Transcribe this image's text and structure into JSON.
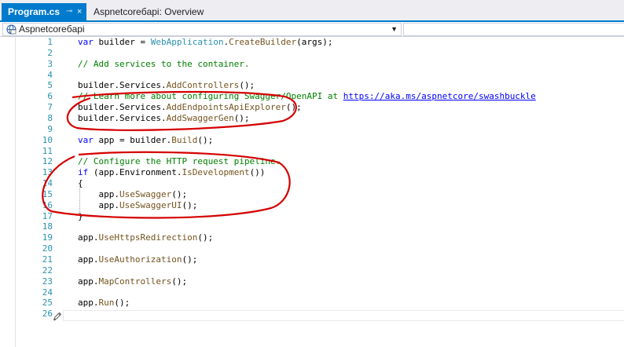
{
  "tabs": [
    {
      "label": "Program.cs",
      "active": true,
      "pin_glyph": "⊸",
      "close_glyph": "×"
    },
    {
      "label": "Aspnetcoreбapi: Overview",
      "active": false
    }
  ],
  "navbar": {
    "project": "Aspnetcoreбapi"
  },
  "colors": {
    "accent": "#007acc",
    "keyword": "#0000ff",
    "type": "#2b91af",
    "method": "#74531f",
    "comment": "#008000",
    "line_number": "#2b91af",
    "annotation": "#d40000"
  },
  "code_lines": [
    {
      "num": "1",
      "parts": [
        [
          "kw",
          "var"
        ],
        [
          "t",
          " builder = "
        ],
        [
          "ty",
          "WebApplication"
        ],
        [
          "t",
          "."
        ],
        [
          "me",
          "CreateBuilder"
        ],
        [
          "t",
          "(args);"
        ]
      ]
    },
    {
      "num": "2",
      "parts": []
    },
    {
      "num": "3",
      "parts": [
        [
          "cm",
          "// Add services to the container."
        ]
      ]
    },
    {
      "num": "4",
      "parts": []
    },
    {
      "num": "5",
      "parts": [
        [
          "t",
          "builder.Services."
        ],
        [
          "me",
          "AddControllers"
        ],
        [
          "t",
          "();"
        ]
      ]
    },
    {
      "num": "6",
      "parts": [
        [
          "cm",
          "// Learn more about configuring Swagger/OpenAPI at "
        ],
        [
          "ul",
          "https://aka.ms/aspnetcore/swashbuckle"
        ]
      ]
    },
    {
      "num": "7",
      "parts": [
        [
          "t",
          "builder.Services."
        ],
        [
          "me",
          "AddEndpointsApiExplorer"
        ],
        [
          "t",
          "();"
        ]
      ]
    },
    {
      "num": "8",
      "parts": [
        [
          "t",
          "builder.Services."
        ],
        [
          "me",
          "AddSwaggerGen"
        ],
        [
          "t",
          "();"
        ]
      ]
    },
    {
      "num": "9",
      "parts": []
    },
    {
      "num": "10",
      "parts": [
        [
          "kw",
          "var"
        ],
        [
          "t",
          " app = builder."
        ],
        [
          "me",
          "Build"
        ],
        [
          "t",
          "();"
        ]
      ]
    },
    {
      "num": "11",
      "parts": []
    },
    {
      "num": "12",
      "parts": [
        [
          "cm",
          "// Configure the HTTP request pipeline."
        ]
      ]
    },
    {
      "num": "13",
      "parts": [
        [
          "kw",
          "if"
        ],
        [
          "t",
          " (app.Environment."
        ],
        [
          "me",
          "IsDevelopment"
        ],
        [
          "t",
          "())"
        ]
      ]
    },
    {
      "num": "14",
      "parts": [
        [
          "t",
          "{"
        ]
      ]
    },
    {
      "num": "15",
      "parts": [
        [
          "t",
          "    app."
        ],
        [
          "me",
          "UseSwagger"
        ],
        [
          "t",
          "();"
        ]
      ]
    },
    {
      "num": "16",
      "parts": [
        [
          "t",
          "    app."
        ],
        [
          "me",
          "UseSwaggerUI"
        ],
        [
          "t",
          "();"
        ]
      ]
    },
    {
      "num": "17",
      "parts": [
        [
          "t",
          "}"
        ]
      ]
    },
    {
      "num": "18",
      "parts": []
    },
    {
      "num": "19",
      "parts": [
        [
          "t",
          "app."
        ],
        [
          "me",
          "UseHttpsRedirection"
        ],
        [
          "t",
          "();"
        ]
      ]
    },
    {
      "num": "20",
      "parts": []
    },
    {
      "num": "21",
      "parts": [
        [
          "t",
          "app."
        ],
        [
          "me",
          "UseAuthorization"
        ],
        [
          "t",
          "();"
        ]
      ]
    },
    {
      "num": "22",
      "parts": []
    },
    {
      "num": "23",
      "parts": [
        [
          "t",
          "app."
        ],
        [
          "me",
          "MapControllers"
        ],
        [
          "t",
          "();"
        ]
      ]
    },
    {
      "num": "24",
      "parts": []
    },
    {
      "num": "25",
      "parts": [
        [
          "t",
          "app."
        ],
        [
          "me",
          "Run"
        ],
        [
          "t",
          "();"
        ]
      ]
    },
    {
      "num": "26",
      "parts": []
    }
  ]
}
